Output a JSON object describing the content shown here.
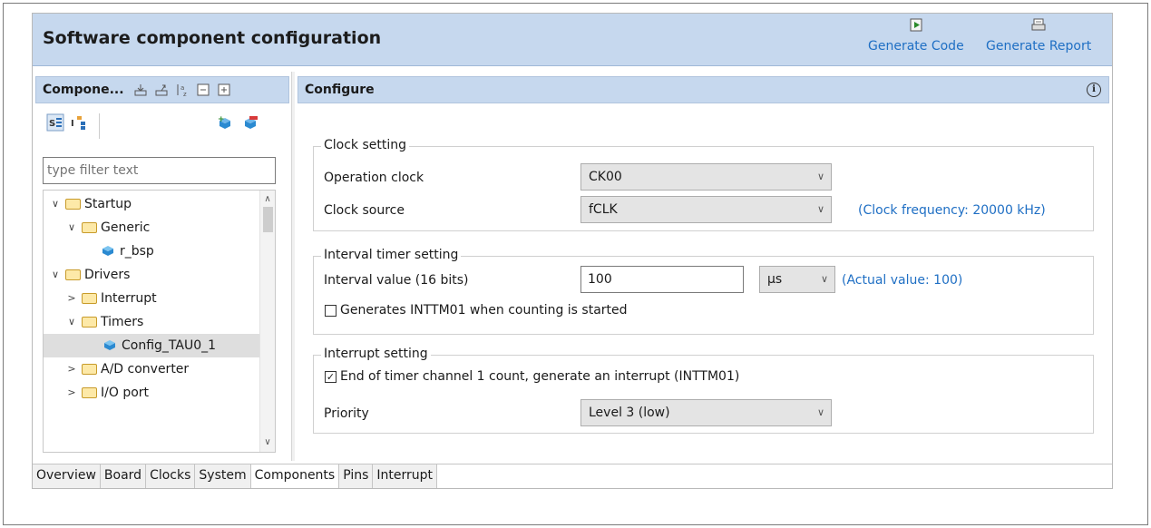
{
  "header": {
    "title": "Software component configuration",
    "generate_code": "Generate Code",
    "generate_report": "Generate Report"
  },
  "left_panel": {
    "title": "Compone...",
    "filter_placeholder": "type filter text",
    "tree": [
      {
        "label": "Startup",
        "level": 0,
        "type": "folder",
        "expanded": true
      },
      {
        "label": "Generic",
        "level": 1,
        "type": "folder",
        "expanded": true
      },
      {
        "label": "r_bsp",
        "level": 2,
        "type": "component"
      },
      {
        "label": "Drivers",
        "level": 0,
        "type": "folder",
        "expanded": true
      },
      {
        "label": "Interrupt",
        "level": 1,
        "type": "folder",
        "expanded": false
      },
      {
        "label": "Timers",
        "level": 1,
        "type": "folder",
        "expanded": true
      },
      {
        "label": "Config_TAU0_1",
        "level": 2,
        "type": "component",
        "selected": true
      },
      {
        "label": "A/D converter",
        "level": 1,
        "type": "folder",
        "expanded": false
      },
      {
        "label": "I/O port",
        "level": 1,
        "type": "folder",
        "expanded": false
      }
    ]
  },
  "configure": {
    "title": "Configure",
    "clock": {
      "title": "Clock setting",
      "op_clock_label": "Operation clock",
      "op_clock_value": "CK00",
      "clock_source_label": "Clock source",
      "clock_source_value": "fCLK",
      "clock_freq": "(Clock frequency: 20000 kHz)"
    },
    "interval": {
      "title": "Interval timer setting",
      "value_label": "Interval value (16 bits)",
      "value": "100",
      "unit": "µs",
      "actual": "(Actual value: 100)",
      "gen_label": "Generates INTTM01 when counting is started",
      "gen_checked": false
    },
    "interrupt": {
      "title": "Interrupt setting",
      "end_label": "End of timer channel 1 count, generate an interrupt (INTTM01)",
      "end_checked": true,
      "priority_label": "Priority",
      "priority_value": "Level 3 (low)"
    }
  },
  "tabs": [
    "Overview",
    "Board",
    "Clocks",
    "System",
    "Components",
    "Pins",
    "Interrupt"
  ],
  "active_tab": "Components",
  "colors": {
    "header_bg": "#c6d8ee",
    "link_blue": "#1f6fc4"
  }
}
